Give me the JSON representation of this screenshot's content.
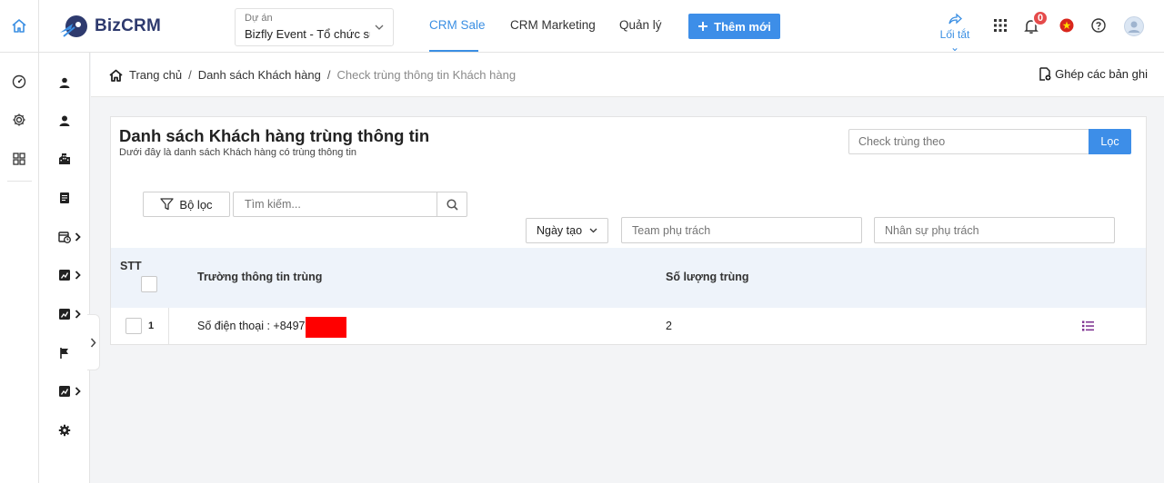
{
  "header": {
    "logo_text": "BizCRM",
    "project_label": "Dự án",
    "project_value": "Bizfly Event - Tổ chức sự kiện",
    "tabs": [
      "CRM Sale",
      "CRM Marketing",
      "Quản lý"
    ],
    "active_tab": "CRM Sale",
    "add_button": "Thêm mới",
    "shortcut_label": "Lối tắt",
    "notification_count": "0",
    "accent_color": "#3d8ee8"
  },
  "breadcrumb": {
    "home": "Trang chủ",
    "level2": "Danh sách Khách hàng",
    "current": "Check trùng thông tin Khách hàng",
    "merge_label": "Ghép các bản ghi"
  },
  "main": {
    "title": "Danh sách Khách hàng trùng thông tin",
    "subtitle": "Dưới đây là danh sách Khách hàng có trùng thông tin",
    "check_placeholder": "Check trùng theo",
    "filter_button": "Lọc",
    "filter_toggle": "Bộ lọc",
    "search_placeholder": "Tìm kiếm...",
    "date_select": "Ngày tạo",
    "team_placeholder": "Team phụ trách",
    "staff_placeholder": "Nhân sự phụ trách"
  },
  "table": {
    "columns": [
      "STT",
      "Trường thông tin trùng",
      "Số lượng trùng"
    ],
    "rows": [
      {
        "stt": "1",
        "field": "Số điện thoại : +8497",
        "count": "2"
      }
    ]
  },
  "icons": {
    "topbar": [
      "home-icon",
      "share-icon",
      "apps-grid-icon",
      "bell-icon",
      "vietnam-flag-icon",
      "help-icon",
      "user-avatar-icon"
    ],
    "rail": [
      "dashboard-icon",
      "settings-icon",
      "modules-icon"
    ],
    "sidebar": [
      "contact-icon",
      "user-icon",
      "company-icon",
      "document-icon",
      "calendar-icon",
      "report-icon",
      "report-icon",
      "flag-icon",
      "report-icon",
      "gear-icon"
    ]
  }
}
